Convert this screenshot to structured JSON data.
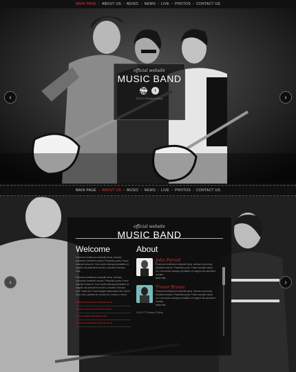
{
  "nav": {
    "items": [
      {
        "label": "MAIN PAGE"
      },
      {
        "label": "ABOUT US"
      },
      {
        "label": "MUSIC"
      },
      {
        "label": "NEWS"
      },
      {
        "label": "LIVE"
      },
      {
        "label": "PHOTOS"
      },
      {
        "label": "CONTACT US"
      }
    ]
  },
  "hero": {
    "tagline": "official website",
    "title": "MUSIC BAND",
    "social": [
      "You Tube",
      "f"
    ],
    "copyright": "2014 © Privacy Policy"
  },
  "page2": {
    "tagline": "official website",
    "title": "MUSIC BAND",
    "welcome_title": "Welcome",
    "about_title": "About",
    "p1": "Praesent vestibulum molestie lacus. Aenean nonummy hendrerit mauris. Phasellus porta. Fusce suscipit varius mi. Cum sociis natoque penatibus et magnis dis parturient montes, nascetur ridiculus mus.",
    "p2": "Praesent vestibulum molestie lacus. Aenean nonummy hendrerit mauris. Phasellus porta. Fusce suscipit varius mi. Cum sociis natoque penatibus et magnis dis parturient montes, nascetur ridiculus mus. Nulla dui. Fusce feugiat malesuada odio. Morbi nunc odio, gravida at, cursus nec, luctus a, lorem.",
    "bullets": [
      "Praesent vestibulum molestie lacus",
      "Aenean nonummy hendrerit mauris",
      "Fusce feugiat malesuada odio",
      "Praesent vestibulum molestie lacus"
    ],
    "members": [
      {
        "name": "John Ferrell",
        "text": "Praesent vestibulum molestie lacus. Aenean nonummy hendrerit mauris. Phasellus porta. Fusce suscipit varius mi. Cum sociis natoque penatibus et magnis dis parturient montes.",
        "more": "more info"
      },
      {
        "name": "Trevor Brown",
        "text": "Praesent vestibulum molestie lacus. Aenean nonummy hendrerit mauris. Phasellus porta. Fusce suscipit varius mi. Cum sociis natoque penatibus et magnis dis parturient montes.",
        "more": "more info"
      }
    ],
    "copyright": "2014 © Privacy Policy"
  },
  "colors": {
    "accent": "#e03a3a",
    "panel": "#141414"
  }
}
